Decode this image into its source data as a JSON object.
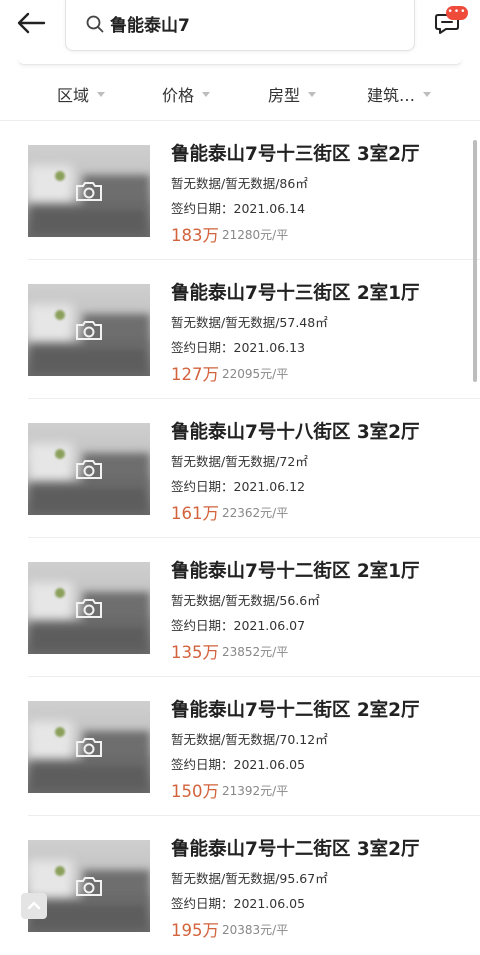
{
  "search": {
    "query": "鲁能泰山7"
  },
  "header": {
    "badge": "•••"
  },
  "filters": [
    {
      "label": "区域"
    },
    {
      "label": "价格"
    },
    {
      "label": "房型"
    },
    {
      "label": "建筑…"
    }
  ],
  "listings": [
    {
      "title": "鲁能泰山7号十三街区 3室2厅",
      "meta": "暂无数据/暂无数据/86㎡",
      "date": "签约日期：2021.06.14",
      "price": "183万",
      "unit_price": "21280元/平"
    },
    {
      "title": "鲁能泰山7号十三街区 2室1厅",
      "meta": "暂无数据/暂无数据/57.48㎡",
      "date": "签约日期：2021.06.13",
      "price": "127万",
      "unit_price": "22095元/平"
    },
    {
      "title": "鲁能泰山7号十八街区 3室2厅",
      "meta": "暂无数据/暂无数据/72㎡",
      "date": "签约日期：2021.06.12",
      "price": "161万",
      "unit_price": "22362元/平"
    },
    {
      "title": "鲁能泰山7号十二街区 2室1厅",
      "meta": "暂无数据/暂无数据/56.6㎡",
      "date": "签约日期：2021.06.07",
      "price": "135万",
      "unit_price": "23852元/平"
    },
    {
      "title": "鲁能泰山7号十二街区 2室2厅",
      "meta": "暂无数据/暂无数据/70.12㎡",
      "date": "签约日期：2021.06.05",
      "price": "150万",
      "unit_price": "21392元/平"
    },
    {
      "title": "鲁能泰山7号十二街区 3室2厅",
      "meta": "暂无数据/暂无数据/95.67㎡",
      "date": "签约日期：2021.06.05",
      "price": "195万",
      "unit_price": "20383元/平"
    }
  ],
  "colors": {
    "price": "#d2633c",
    "badge": "#ee4b3b"
  },
  "icons": [
    "back-arrow-icon",
    "search-icon",
    "message-icon",
    "camera-icon",
    "scroll-to-top-icon"
  ]
}
